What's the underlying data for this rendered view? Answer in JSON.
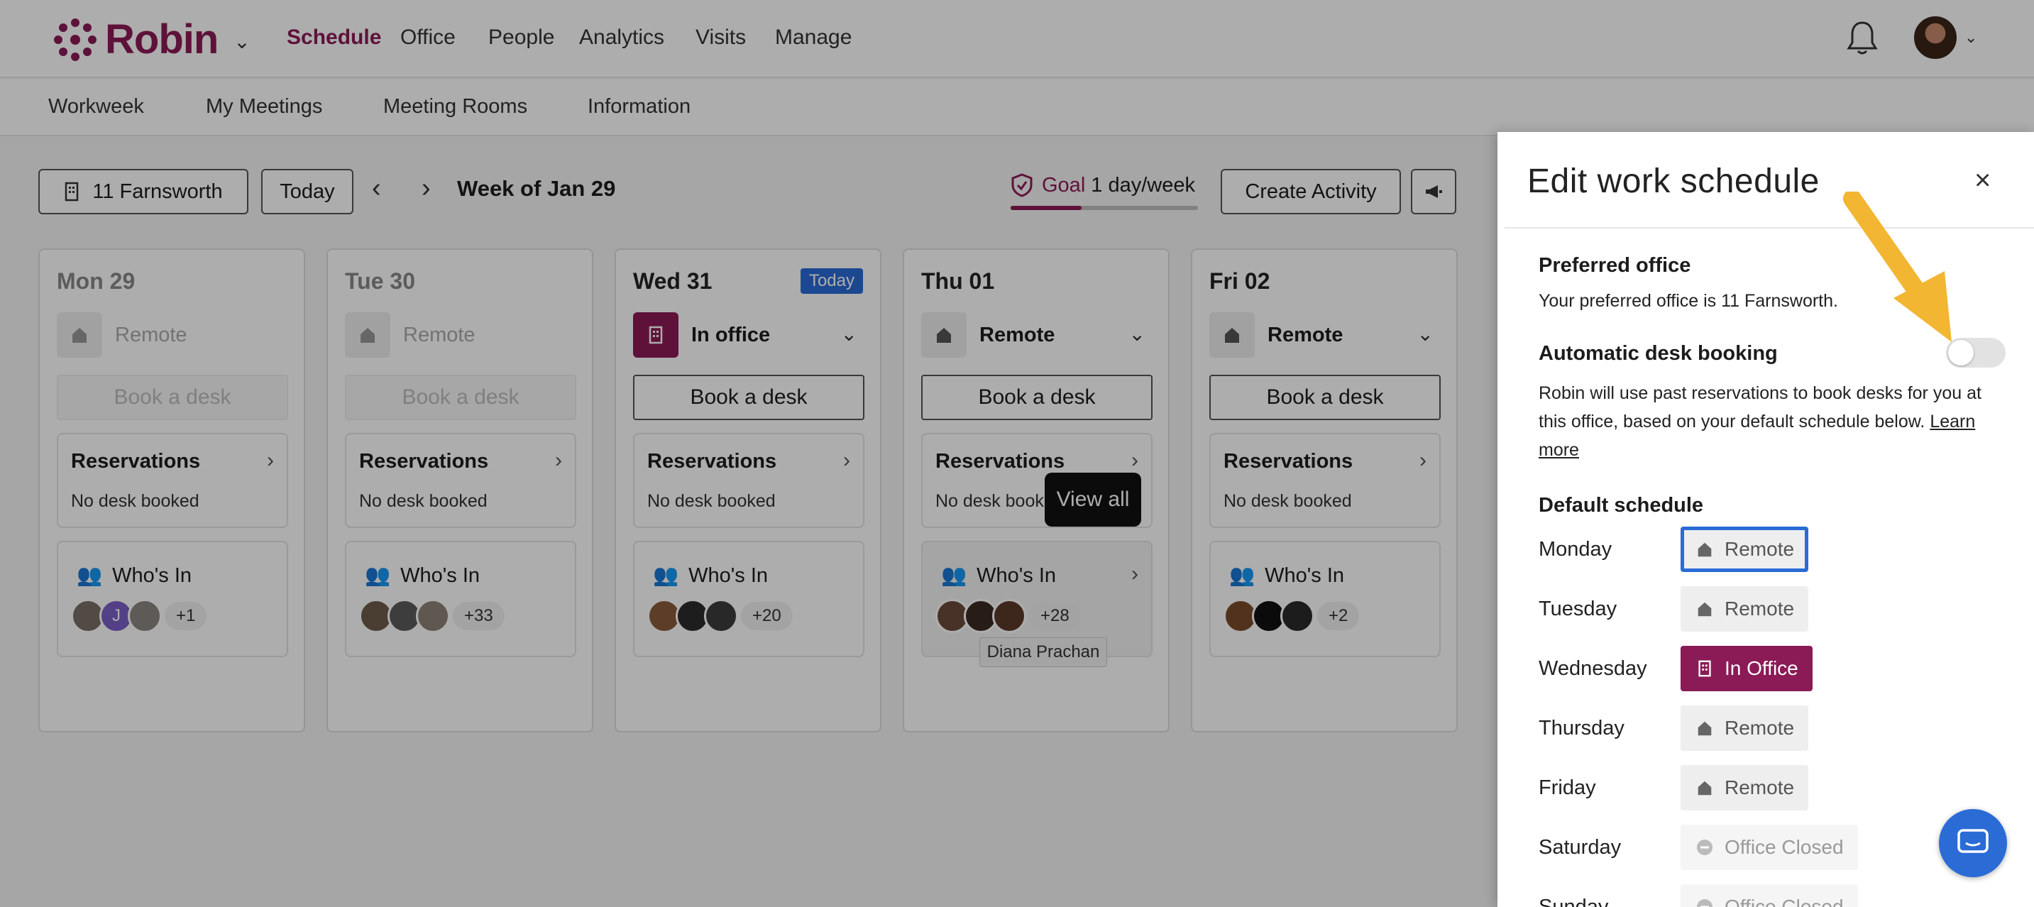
{
  "brand": {
    "name": "Robin",
    "color": "#8b1b56"
  },
  "topnav": {
    "items": [
      "Schedule",
      "Office",
      "People",
      "Analytics",
      "Visits",
      "Manage"
    ],
    "active": "Schedule"
  },
  "subnav": {
    "items": [
      "Workweek",
      "My Meetings",
      "Meeting Rooms",
      "Information"
    ]
  },
  "toolbar": {
    "location": "11 Farnsworth",
    "today": "Today",
    "week_label": "Week of Jan 29",
    "goal_label": "Goal",
    "goal_value": "1 day/week",
    "create_activity": "Create Activity"
  },
  "days": [
    {
      "title": "Mon 29",
      "status": "Remote",
      "book": "Book a desk",
      "res_title": "Reservations",
      "res_sub": "No desk booked",
      "who": "Who's In",
      "more": "+1"
    },
    {
      "title": "Tue 30",
      "status": "Remote",
      "book": "Book a desk",
      "res_title": "Reservations",
      "res_sub": "No desk booked",
      "who": "Who's In",
      "more": "+33"
    },
    {
      "title": "Wed 31",
      "status": "In office",
      "book": "Book a desk",
      "res_title": "Reservations",
      "res_sub": "No desk booked",
      "who": "Who's In",
      "more": "+20",
      "badge": "Today"
    },
    {
      "title": "Thu 01",
      "status": "Remote",
      "book": "Book a desk",
      "res_title": "Reservations",
      "res_sub": "No desk booked",
      "who": "Who's In",
      "more": "+28"
    },
    {
      "title": "Fri 02",
      "status": "Remote",
      "book": "Book a desk",
      "res_title": "Reservations",
      "res_sub": "No desk booked",
      "who": "Who's In",
      "more": "+2"
    }
  ],
  "tooltips": {
    "view_all": "View all",
    "person": "Diana Prachan"
  },
  "panel": {
    "title": "Edit work schedule",
    "preferred_office_label": "Preferred office",
    "preferred_office_text": "Your preferred office is 11 Farnsworth.",
    "auto_booking_label": "Automatic desk booking",
    "auto_booking_desc": "Robin will use past reservations to book desks for you at this office, based on your default schedule below.",
    "learn_more": "Learn more",
    "default_schedule_label": "Default schedule",
    "schedule": [
      {
        "day": "Monday",
        "value": "Remote"
      },
      {
        "day": "Tuesday",
        "value": "Remote"
      },
      {
        "day": "Wednesday",
        "value": "In Office"
      },
      {
        "day": "Thursday",
        "value": "Remote"
      },
      {
        "day": "Friday",
        "value": "Remote"
      },
      {
        "day": "Saturday",
        "value": "Office Closed"
      },
      {
        "day": "Sunday",
        "value": "Office Closed"
      }
    ]
  },
  "colors": {
    "accent": "#8b1b56",
    "blue": "#2a6bd6",
    "annotation": "#f2b632"
  }
}
